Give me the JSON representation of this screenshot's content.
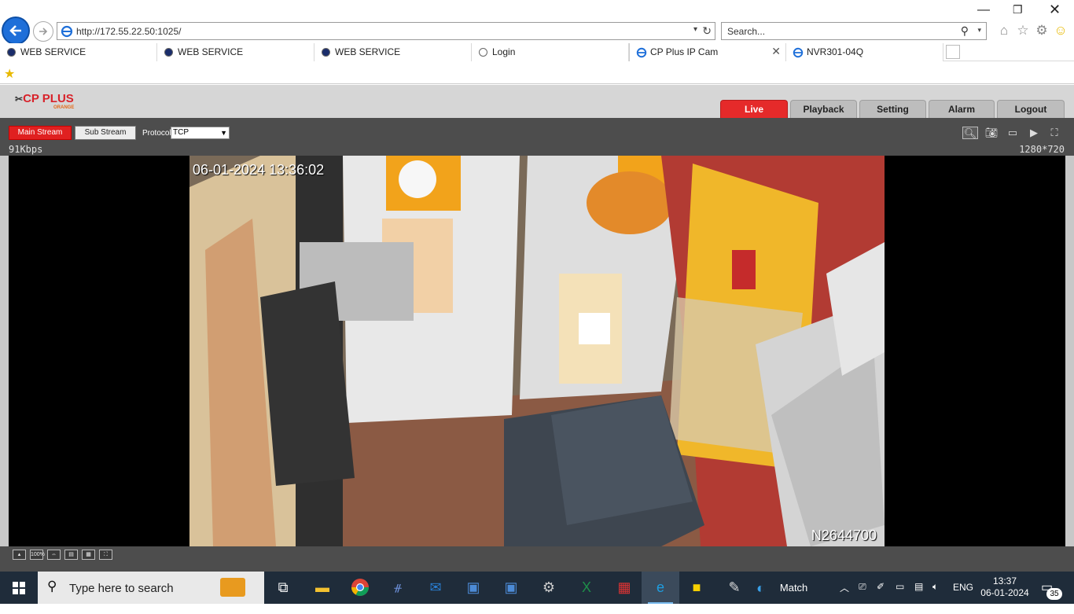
{
  "browser": {
    "url": "http://172.55.22.50:1025/",
    "search_placeholder": "Search...",
    "tabs": [
      {
        "label": "WEB SERVICE",
        "icon": "globe-icon"
      },
      {
        "label": "WEB SERVICE",
        "icon": "globe-icon"
      },
      {
        "label": "WEB SERVICE",
        "icon": "globe-icon"
      },
      {
        "label": "Login",
        "icon": "loading-icon"
      },
      {
        "label": "CP Plus IP Cam",
        "icon": "ie-icon",
        "active": true
      },
      {
        "label": "NVR301-04Q",
        "icon": "ie-icon"
      }
    ]
  },
  "app": {
    "logo_text": "CP PLUS",
    "logo_sub": "ORANGE",
    "nav": {
      "live": "Live",
      "playback": "Playback",
      "setting": "Setting",
      "alarm": "Alarm",
      "logout": "Logout"
    },
    "stream": {
      "main": "Main Stream",
      "sub": "Sub Stream",
      "protocol_label": "Protocol",
      "protocol_value": "TCP"
    },
    "bitrate": "91Kbps",
    "resolution": "1280*720",
    "osd_time": "06-01-2024 13:36:02",
    "osd_id": "N2644700",
    "bottom_icons": [
      "",
      "100%",
      "",
      "",
      "",
      ""
    ]
  },
  "taskbar": {
    "search_placeholder": "Type here to search",
    "weather_label": "Match",
    "language": "ENG",
    "time": "13:37",
    "date": "06-01-2024",
    "notification_count": "35"
  },
  "colors": {
    "accent_red": "#e52a2a",
    "taskbar": "#1f2c3a"
  }
}
